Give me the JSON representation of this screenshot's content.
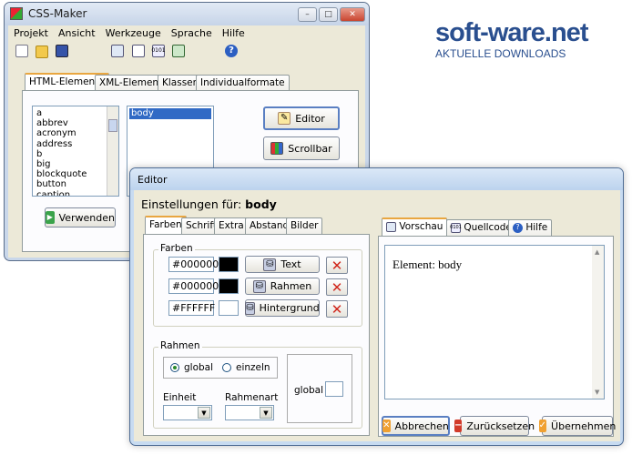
{
  "watermark": {
    "brand": "soft-ware.net",
    "tagline": "AKTUELLE DOWNLOADS"
  },
  "main_window": {
    "title": "CSS-Maker",
    "menu": [
      "Projekt",
      "Ansicht",
      "Werkzeuge",
      "Sprache",
      "Hilfe"
    ],
    "tabs": [
      "HTML-Elemente",
      "XML-Elemente",
      "Klassen",
      "Individualformate"
    ],
    "elements_list": [
      "a",
      "abbrev",
      "acronym",
      "address",
      "b",
      "big",
      "blockquote",
      "button",
      "caption"
    ],
    "selected_list": [
      "body"
    ],
    "side_buttons": [
      "Editor",
      "Scrollbar"
    ],
    "use_button": "Verwenden",
    "window_controls": [
      "–",
      "□",
      "✕"
    ]
  },
  "editor": {
    "title": "Editor",
    "settings_label": "Einstellungen für:",
    "settings_element": "body",
    "tabs_left": [
      "Farben",
      "Schrift",
      "Extra",
      "Abstand",
      "Bilder"
    ],
    "tabs_right": [
      "Vorschau",
      "Quellcode",
      "Hilfe"
    ],
    "colors_group": "Farben",
    "color_rows": [
      {
        "value": "#000000",
        "swatch": "#000000",
        "button": "Text"
      },
      {
        "value": "#000000",
        "swatch": "#000000",
        "button": "Rahmen"
      },
      {
        "value": "#FFFFFF",
        "swatch": "#ffffff",
        "button": "Hintergrund"
      }
    ],
    "border_group": "Rahmen",
    "radio_global": "global",
    "radio_single": "einzeln",
    "unit_label": "Einheit",
    "border_type_label": "Rahmenart",
    "global_label": "global",
    "preview_text": "Element: body",
    "bottom_buttons": [
      "Abbrechen",
      "Zurücksetzen",
      "Übernehmen"
    ]
  },
  "colors": {
    "titlebar_main": "#d6e0ee",
    "editor_title": "#c4d9f0",
    "accent_orange": "#e9a640",
    "xp_blue": "#7f9db9",
    "close_red": "#c94a3a"
  }
}
